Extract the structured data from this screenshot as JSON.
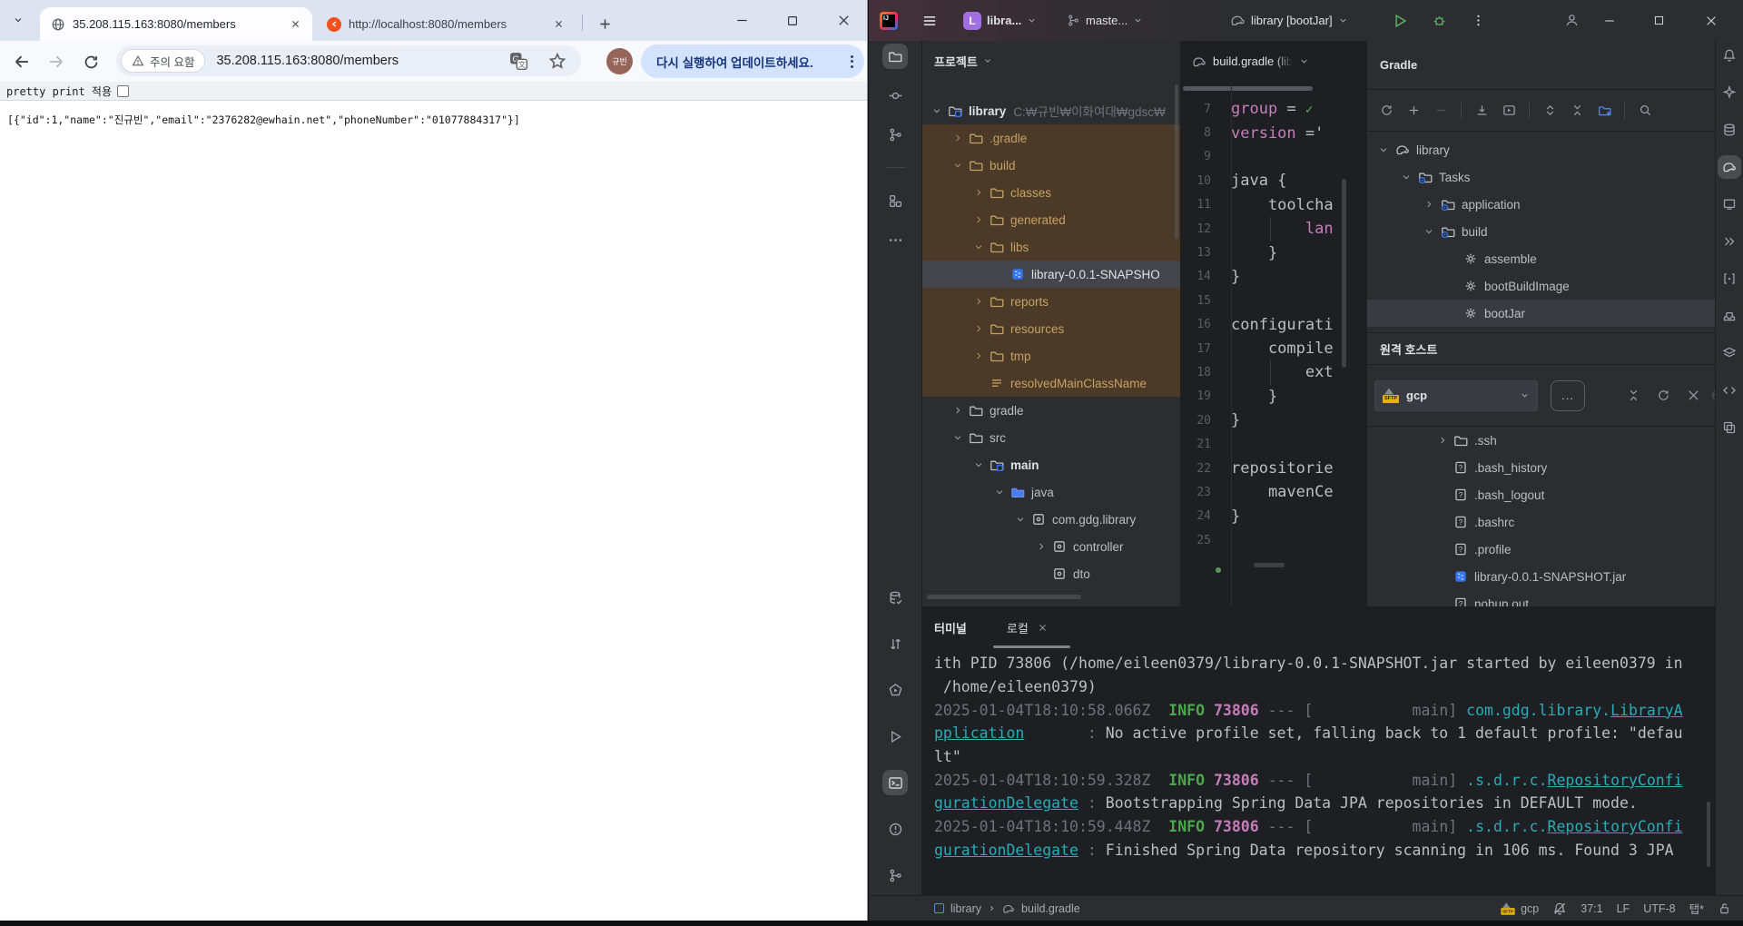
{
  "browser": {
    "tabs": [
      {
        "title": "35.208.115.163:8080/members",
        "favicon": "globe"
      },
      {
        "title": "http://localhost:8080/members",
        "favicon": "orange"
      }
    ],
    "toolbar": {
      "warning_chip": "주의 요함",
      "url": "35.208.115.163:8080/members",
      "avatar_label": "규빈",
      "update_pill": "다시 실행하여 업데이트하세요."
    },
    "pretty_print_label": "pretty print 적용",
    "json_body": "[{\"id\":1,\"name\":\"진규빈\",\"email\":\"2376282@ewhain.net\",\"phoneNumber\":\"01077884317\"}]"
  },
  "ide": {
    "titlebar": {
      "project_label": "libra...",
      "branch_label": "maste...",
      "run_config_label": "library [bootJar]"
    },
    "left_stripe_top": [
      {
        "icon": "folder",
        "name": "project",
        "selected": true
      },
      {
        "icon": "commit",
        "name": "commit"
      },
      {
        "icon": "vcs",
        "name": "version-control"
      },
      {
        "icon": "sep"
      },
      {
        "icon": "structure",
        "name": "structure"
      },
      {
        "icon": "more",
        "name": "more-tool-windows"
      }
    ],
    "left_stripe_bottom": [
      {
        "icon": "dbcheck",
        "name": "database-changes"
      },
      {
        "icon": "updown",
        "name": "sync"
      },
      {
        "icon": "profiler",
        "name": "profiler"
      },
      {
        "icon": "run",
        "name": "run"
      },
      {
        "icon": "terminal",
        "name": "terminal",
        "selected": true
      },
      {
        "icon": "problems",
        "name": "problems"
      },
      {
        "icon": "vcs",
        "name": "git"
      }
    ],
    "right_stripe": [
      {
        "icon": "bell",
        "name": "notifications"
      },
      {
        "icon": "ai",
        "name": "ai-assistant"
      },
      {
        "icon": "database",
        "name": "database"
      },
      {
        "icon": "elephant",
        "name": "gradle",
        "selected": true
      },
      {
        "icon": "device",
        "name": "device-manager"
      },
      {
        "icon": "chev2r",
        "name": "run-anything"
      },
      {
        "icon": "endpoints",
        "name": "endpoints"
      },
      {
        "icon": "tray",
        "name": "dependencies"
      },
      {
        "icon": "layers",
        "name": "build"
      },
      {
        "icon": "code",
        "name": "documentation"
      },
      {
        "icon": "copy",
        "name": "bookmarks"
      }
    ],
    "project_panel": {
      "title": "프로젝트",
      "tree": [
        {
          "label": "library",
          "path": "C:₩규빈₩이화여대₩gdsc₩",
          "lvl": 0,
          "chev": "open",
          "icon": "folderproj",
          "bold": true
        },
        {
          "label": ".gradle",
          "lvl": 1,
          "chev": "closed",
          "icon": "folder",
          "bg": "brown"
        },
        {
          "label": "build",
          "lvl": 1,
          "chev": "open",
          "icon": "folder",
          "bg": "brown"
        },
        {
          "label": "classes",
          "lvl": 2,
          "chev": "closed",
          "icon": "folder",
          "bg": "brown"
        },
        {
          "label": "generated",
          "lvl": 2,
          "chev": "closed",
          "icon": "folder",
          "bg": "brown"
        },
        {
          "label": "libs",
          "lvl": 2,
          "chev": "open",
          "icon": "folder",
          "bg": "brown"
        },
        {
          "label": "library-0.0.1-SNAPSHO",
          "lvl": 3,
          "chev": "none",
          "icon": "jar",
          "bg": "selected"
        },
        {
          "label": "reports",
          "lvl": 2,
          "chev": "closed",
          "icon": "folder",
          "bg": "brown"
        },
        {
          "label": "resources",
          "lvl": 2,
          "chev": "closed",
          "icon": "folder",
          "bg": "brown"
        },
        {
          "label": "tmp",
          "lvl": 2,
          "chev": "closed",
          "icon": "folder",
          "bg": "brown"
        },
        {
          "label": "resolvedMainClassName",
          "lvl": 2,
          "chev": "none",
          "icon": "filetext",
          "bg": "brown"
        },
        {
          "label": "gradle",
          "lvl": 1,
          "chev": "closed",
          "icon": "folder"
        },
        {
          "label": "src",
          "lvl": 1,
          "chev": "open",
          "icon": "folder"
        },
        {
          "label": "main",
          "lvl": 2,
          "chev": "open",
          "icon": "foldersrc",
          "bold": true
        },
        {
          "label": "java",
          "lvl": 3,
          "chev": "open",
          "icon": "folderblue"
        },
        {
          "label": "com.gdg.library",
          "lvl": 4,
          "chev": "open",
          "icon": "pkg"
        },
        {
          "label": "controller",
          "lvl": 5,
          "chev": "closed",
          "icon": "pkg"
        },
        {
          "label": "dto",
          "lvl": 5,
          "chev": "none",
          "icon": "pkg"
        }
      ]
    },
    "editor": {
      "tab_label": "build.gradle (lib",
      "lines": [
        {
          "n": 7,
          "tokens": [
            [
              "group",
              "k"
            ],
            [
              " = ",
              "f"
            ],
            [
              "✓",
              "c"
            ]
          ]
        },
        {
          "n": 8,
          "tokens": [
            [
              "version",
              "k"
            ],
            [
              " ='",
              "f"
            ]
          ]
        },
        {
          "n": 9,
          "tokens": []
        },
        {
          "n": 10,
          "tokens": [
            [
              "java {",
              "f"
            ]
          ]
        },
        {
          "n": 11,
          "tokens": [
            [
              "    toolcha",
              "f"
            ]
          ]
        },
        {
          "n": 12,
          "tokens": [
            [
              "        lan",
              "k"
            ]
          ],
          "guide": true
        },
        {
          "n": 13,
          "tokens": [
            [
              "    }",
              "f"
            ]
          ]
        },
        {
          "n": 14,
          "tokens": [
            [
              "}",
              "f"
            ]
          ]
        },
        {
          "n": 15,
          "tokens": []
        },
        {
          "n": 16,
          "tokens": [
            [
              "configurati",
              "f"
            ]
          ]
        },
        {
          "n": 17,
          "tokens": [
            [
              "    compile",
              "f"
            ]
          ]
        },
        {
          "n": 18,
          "tokens": [
            [
              "        ext",
              "f"
            ]
          ],
          "guide": true
        },
        {
          "n": 19,
          "tokens": [
            [
              "    }",
              "f"
            ]
          ]
        },
        {
          "n": 20,
          "tokens": [
            [
              "}",
              "f"
            ]
          ]
        },
        {
          "n": 21,
          "tokens": []
        },
        {
          "n": 22,
          "tokens": [
            [
              "repositorie",
              "f"
            ]
          ]
        },
        {
          "n": 23,
          "tokens": [
            [
              "    mavenCe",
              "f"
            ]
          ]
        },
        {
          "n": 24,
          "tokens": [
            [
              "}",
              "f"
            ]
          ]
        },
        {
          "n": 25,
          "tokens": []
        }
      ]
    },
    "gradle_panel": {
      "title": "Gradle",
      "toolbar": [
        "refresh",
        "plus",
        "minus",
        "sep",
        "download",
        "runtask",
        "sep",
        "expand",
        "collapse",
        "folderplus",
        "sep",
        "findtask"
      ],
      "tree": [
        {
          "label": "library",
          "lvl": 0,
          "chev": "open",
          "icon": "elephant"
        },
        {
          "label": "Tasks",
          "lvl": 1,
          "chev": "open",
          "icon": "foldergear"
        },
        {
          "label": "application",
          "lvl": 2,
          "chev": "closed",
          "icon": "foldergear"
        },
        {
          "label": "build",
          "lvl": 2,
          "chev": "open",
          "icon": "foldergear"
        },
        {
          "label": "assemble",
          "lvl": 3,
          "chev": "none",
          "icon": "gear"
        },
        {
          "label": "bootBuildImage",
          "lvl": 3,
          "chev": "none",
          "icon": "gear"
        },
        {
          "label": "bootJar",
          "lvl": 3,
          "chev": "none",
          "icon": "gear",
          "bg": "selected2"
        }
      ]
    },
    "remote_panel": {
      "title": "원격 호스트",
      "host": "gcp",
      "more_button": "...",
      "files": [
        {
          "label": ".ssh",
          "chev": "closed",
          "icon": "folder"
        },
        {
          "label": ".bash_history",
          "chev": "none",
          "icon": "fileq"
        },
        {
          "label": ".bash_logout",
          "chev": "none",
          "icon": "fileq"
        },
        {
          "label": ".bashrc",
          "chev": "none",
          "icon": "fileq"
        },
        {
          "label": ".profile",
          "chev": "none",
          "icon": "fileq"
        },
        {
          "label": "library-0.0.1-SNAPSHOT.jar",
          "chev": "none",
          "icon": "jar"
        },
        {
          "label": "nohup.out",
          "chev": "none",
          "icon": "fileq"
        }
      ]
    },
    "terminal": {
      "title": "터미널",
      "tab": "로컬",
      "log": [
        [
          [
            "ith PID 73806 (/home/eileen0379/library-0.0.1-SNAPSHOT.jar started by eileen0379 in",
            "f"
          ]
        ],
        [
          [
            " /home/eileen0379)",
            "f"
          ]
        ],
        [
          [
            "2025-01-04T18:10:58.066Z",
            "d"
          ],
          [
            "  ",
            "f"
          ],
          [
            "INFO",
            "i"
          ],
          [
            " ",
            "f"
          ],
          [
            "73806",
            "p"
          ],
          [
            " --- [           main] ",
            "d"
          ],
          [
            "com.gdg.library.",
            "t"
          ],
          [
            "LibraryA",
            "l"
          ]
        ],
        [
          [
            "pplication",
            "l"
          ],
          [
            "       : ",
            "d"
          ],
          [
            "No active profile set, falling back to 1 default profile: \"defau",
            "f"
          ]
        ],
        [
          [
            "lt\"",
            "f"
          ]
        ],
        [
          [
            "2025-01-04T18:10:59.328Z",
            "d"
          ],
          [
            "  ",
            "f"
          ],
          [
            "INFO",
            "i"
          ],
          [
            " ",
            "f"
          ],
          [
            "73806",
            "p"
          ],
          [
            " --- [           main] ",
            "d"
          ],
          [
            ".s.d.r.c.",
            "t"
          ],
          [
            "RepositoryConfi",
            "l"
          ]
        ],
        [
          [
            "gurationDelegate",
            "l"
          ],
          [
            " : ",
            "d"
          ],
          [
            "Bootstrapping Spring Data JPA repositories in DEFAULT mode.",
            "f"
          ]
        ],
        [
          [
            "2025-01-04T18:10:59.448Z",
            "d"
          ],
          [
            "  ",
            "f"
          ],
          [
            "INFO",
            "i"
          ],
          [
            " ",
            "f"
          ],
          [
            "73806",
            "p"
          ],
          [
            " --- [           main] ",
            "d"
          ],
          [
            ".s.d.r.c.",
            "t"
          ],
          [
            "RepositoryConfi",
            "l"
          ]
        ],
        [
          [
            "gurationDelegate",
            "l"
          ],
          [
            " : ",
            "d"
          ],
          [
            "Finished Spring Data repository scanning in 106 ms. Found 3 JPA",
            "f"
          ]
        ]
      ]
    },
    "statusbar": {
      "module": "library",
      "file": "build.gradle",
      "host": "gcp",
      "caret": "37:1",
      "line_sep": "LF",
      "encoding": "UTF-8",
      "indent": "탭*"
    }
  },
  "colors": {
    "accent": "#3574f0",
    "brown_highlight": "#4a3a27",
    "selection": "#43454a",
    "info_green": "#4ea64e",
    "pid_pink": "#c77dbb",
    "logger_teal": "#2aacb8",
    "keyword_pink": "#c77dbb",
    "update_pill_bg": "#d3e3fd"
  }
}
